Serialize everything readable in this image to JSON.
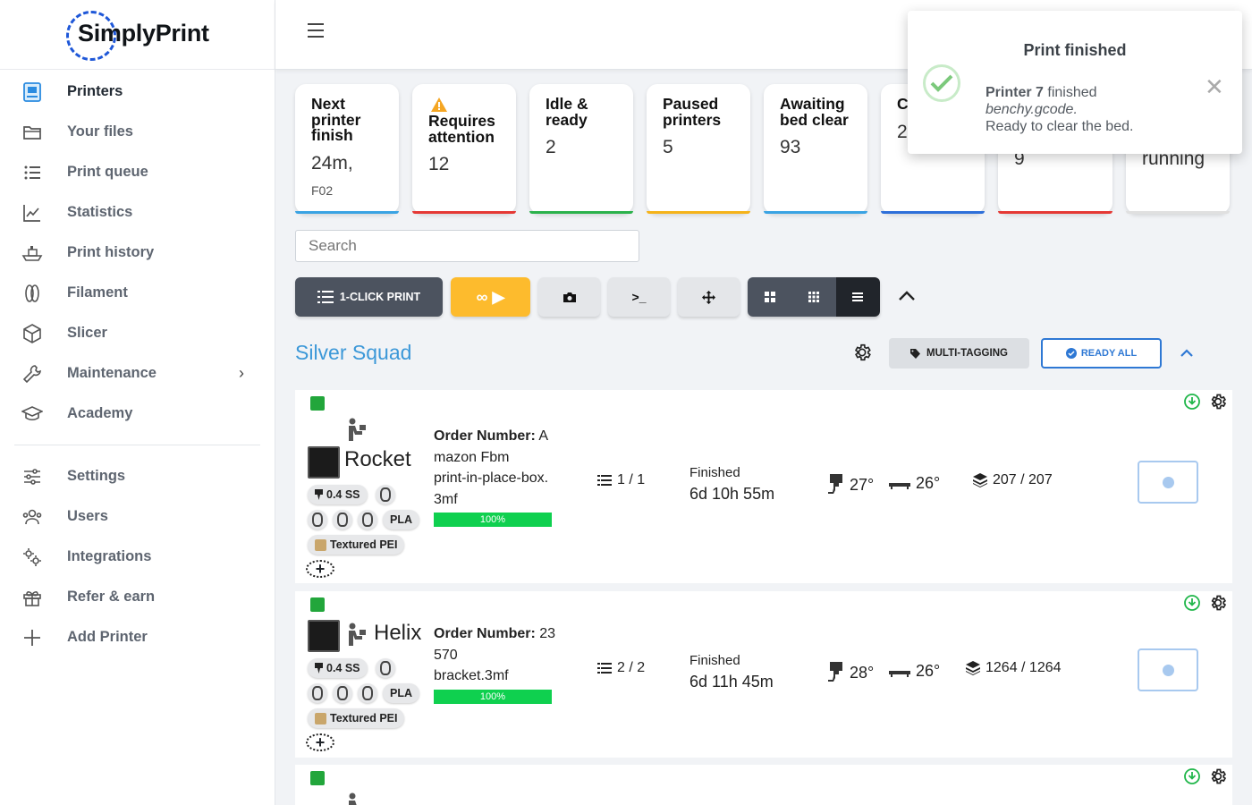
{
  "app": {
    "logo_text": "SimplyPrint"
  },
  "sidebar": {
    "items": [
      {
        "label": "Printers",
        "icon": "printer-icon",
        "active": true
      },
      {
        "label": "Your files",
        "icon": "folder-icon"
      },
      {
        "label": "Print queue",
        "icon": "list-icon"
      },
      {
        "label": "Statistics",
        "icon": "chart-icon"
      },
      {
        "label": "Print history",
        "icon": "boat-icon"
      },
      {
        "label": "Filament",
        "icon": "spool-icon"
      },
      {
        "label": "Slicer",
        "icon": "cube-icon"
      },
      {
        "label": "Maintenance",
        "icon": "wrench-icon",
        "has_submenu": true
      },
      {
        "label": "Academy",
        "icon": "graduation-cap-icon"
      }
    ],
    "items2": [
      {
        "label": "Settings",
        "icon": "sliders-icon"
      },
      {
        "label": "Users",
        "icon": "users-icon"
      },
      {
        "label": "Integrations",
        "icon": "cogs-icon"
      },
      {
        "label": "Refer & earn",
        "icon": "gift-icon"
      },
      {
        "label": "Add Printer",
        "icon": "plus-icon"
      }
    ]
  },
  "stats": [
    {
      "title": "Next printer finish",
      "value": "24m,",
      "sub": "F02",
      "color": "#3aa3e3"
    },
    {
      "title": "Requires attention",
      "value": "12",
      "warning_icon": true,
      "color": "#e53935"
    },
    {
      "title": "Idle & ready",
      "value": "2",
      "color": "#2bb24c"
    },
    {
      "title": "Paused printers",
      "value": "5",
      "color": "#f5b31a"
    },
    {
      "title": "Awaiting bed clear",
      "value": "93",
      "color": "#3aa3e3"
    },
    {
      "title": "C",
      "value": "2",
      "color": "#2e6fd9"
    },
    {
      "title": "",
      "value": "9",
      "color": "#e53935"
    },
    {
      "title": "",
      "value": "running",
      "color": "#e0e0e0"
    }
  ],
  "search": {
    "placeholder": "Search"
  },
  "toolbar": {
    "one_click_label": "1-CLICK PRINT",
    "infinite_label": "∞ ▶",
    "camera_icon": "camera-icon",
    "terminal_label": ">_",
    "move_icon": "move-icon",
    "view_modes": [
      "large-grid",
      "small-grid",
      "list"
    ],
    "selected_view": "list"
  },
  "group": {
    "title": "Silver Squad",
    "multi_tagging_label": "MULTI-TAGGING",
    "ready_all_label": "READY ALL"
  },
  "printers": [
    {
      "name": "Rocket",
      "nozzle": "0.4 SS",
      "material": "PLA",
      "bed": "Textured PEI",
      "order_label": "Order Number:",
      "order_value": "A",
      "job_lines": [
        "mazon Fbm",
        "print-in-place-box.",
        "3mf"
      ],
      "progress": "100%",
      "queue": "1 / 1",
      "state": "Finished",
      "time": "6d 10h 55m",
      "nozzle_temp": "27°",
      "bed_temp": "26°",
      "layers": "207 / 207"
    },
    {
      "name": "Helix",
      "nozzle": "0.4 SS",
      "material": "PLA",
      "bed": "Textured PEI",
      "order_label": "Order Number:",
      "order_value": "23",
      "job_lines": [
        "570",
        "bracket.3mf"
      ],
      "progress": "100%",
      "queue": "2 / 2",
      "state": "Finished",
      "time": "6d 11h 45m",
      "nozzle_temp": "28°",
      "bed_temp": "26°",
      "layers": "1264 / 1264"
    }
  ],
  "toast": {
    "title": "Print finished",
    "printer": "Printer 7",
    "verb": "finished",
    "file": "benchy.gcode.",
    "message": "Ready to clear the bed."
  }
}
